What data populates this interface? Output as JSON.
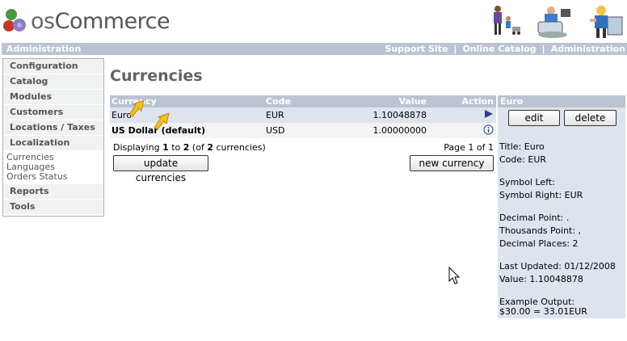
{
  "header": {
    "logo_prefix": "os",
    "logo_text": "Commerce"
  },
  "navbar": {
    "left": "Administration",
    "links": [
      "Support Site",
      "Online Catalog",
      "Administration"
    ],
    "separator": "|"
  },
  "sidebar": {
    "sections": [
      {
        "label": "Configuration"
      },
      {
        "label": "Catalog"
      },
      {
        "label": "Modules"
      },
      {
        "label": "Customers"
      },
      {
        "label": "Locations / Taxes"
      },
      {
        "label": "Localization",
        "items": [
          "Currencies",
          "Languages",
          "Orders Status"
        ]
      },
      {
        "label": "Reports"
      },
      {
        "label": "Tools"
      }
    ]
  },
  "main": {
    "title": "Currencies",
    "columns": {
      "currency": "Currency",
      "code": "Code",
      "value": "Value",
      "action": "Action"
    },
    "rows": [
      {
        "name": "Euro",
        "code": "EUR",
        "value": "1.10048878",
        "action_icon": "play-arrow-icon"
      },
      {
        "name": "US Dollar (default)",
        "code": "USD",
        "value": "1.00000000",
        "action_icon": "info-icon"
      }
    ],
    "pager": {
      "display_prefix": "Displaying",
      "from": "1",
      "to_word": "to",
      "to": "2",
      "of_prefix": "(of",
      "total": "2",
      "suffix": "currencies)",
      "page_text": "Page 1 of 1"
    },
    "buttons": {
      "update": "update currencies",
      "new": "new currency"
    }
  },
  "info": {
    "heading": "Euro",
    "edit": "edit",
    "delete": "delete",
    "title": "Title: Euro",
    "code": "Code: EUR",
    "symbol_left": "Symbol Left:",
    "symbol_right": "Symbol Right: EUR",
    "decimal_point": "Decimal Point: .",
    "thousands_point": "Thousands Point: ,",
    "decimal_places": "Decimal Places: 2",
    "last_updated": "Last Updated: 01/12/2008",
    "value": "Value: 1.10048878",
    "example_label": "Example Output:",
    "example_value": "$30.00 = 33.01EUR"
  },
  "colors": {
    "bar": "#bbc3d3",
    "selected": "#dde4ee",
    "title": "#626262"
  }
}
